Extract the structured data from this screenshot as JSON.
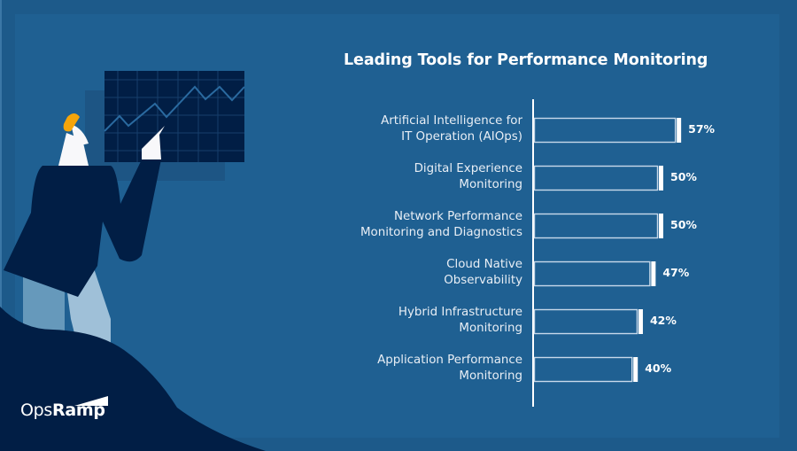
{
  "brand": {
    "logo_light": "Ops",
    "logo_bold": "Ramp"
  },
  "colors": {
    "background": "#1f6092",
    "illustration_dark": "#011e45",
    "accent_hair": "#f5a50a",
    "bar_outline": "#c8d9ea",
    "bar_cap": "#ffffff"
  },
  "chart_data": {
    "type": "bar",
    "orientation": "horizontal",
    "title": "Leading Tools for Performance Monitoring",
    "xlabel": "",
    "ylabel": "",
    "xlim": [
      0,
      100
    ],
    "grid": false,
    "legend": "none",
    "categories": [
      [
        "Artificial Intelligence for",
        "IT Operation (AIOps)"
      ],
      [
        "Digital Experience",
        "Monitoring"
      ],
      [
        "Network Performance",
        "Monitoring and Diagnostics"
      ],
      [
        "Cloud Native",
        "Observability"
      ],
      [
        "Hybrid Infrastructure",
        "Monitoring"
      ],
      [
        "Application Performance",
        "Monitoring"
      ]
    ],
    "values": [
      57,
      50,
      50,
      47,
      42,
      40
    ],
    "value_labels": [
      "57%",
      "50%",
      "50%",
      "47%",
      "42%",
      "40%"
    ]
  }
}
